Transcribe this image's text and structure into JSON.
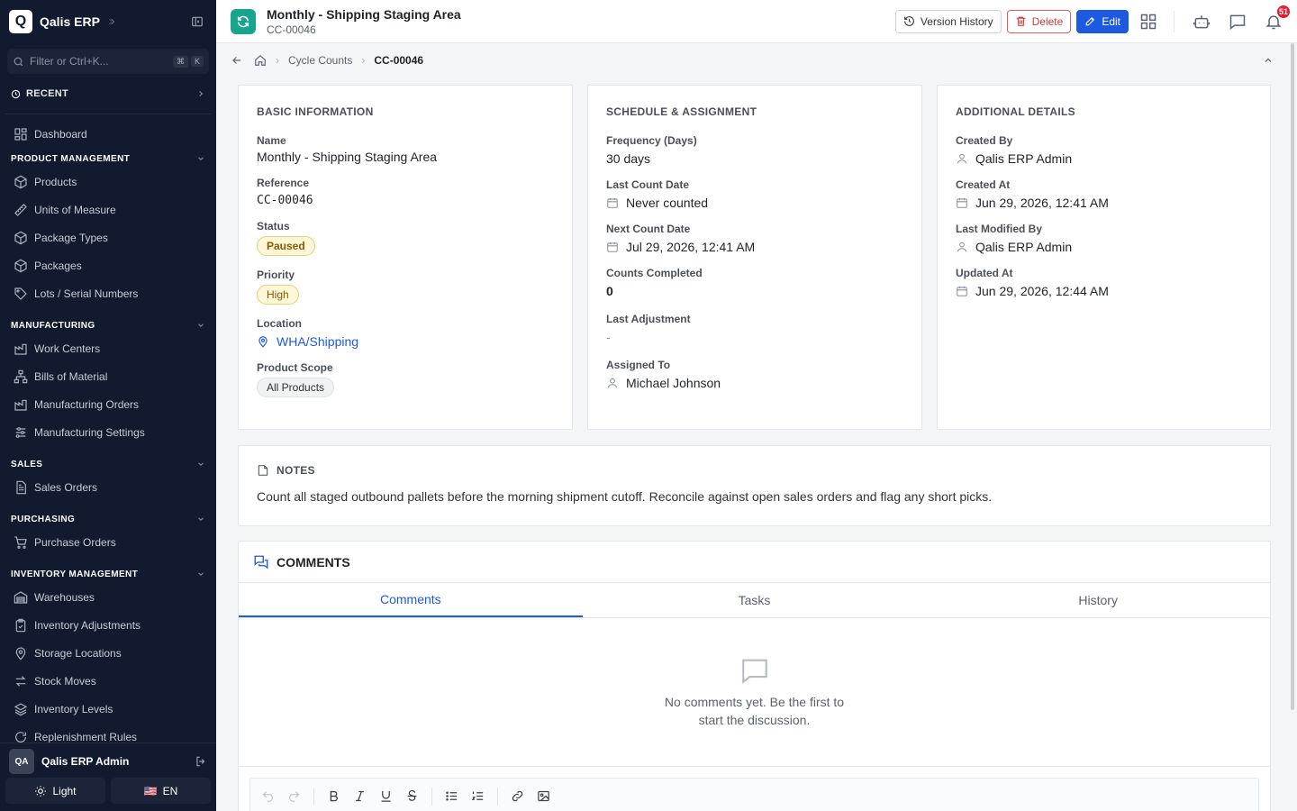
{
  "app": {
    "name": "Qalis ERP",
    "logo_letter": "Q"
  },
  "sidebar": {
    "filter_placeholder": "Filter or Ctrl+K...",
    "kbd_1": "⌘",
    "kbd_2": "K",
    "recent_label": "RECENT",
    "dashboard": "Dashboard",
    "sections": {
      "product": "PRODUCT MANAGEMENT",
      "manufacturing": "MANUFACTURING",
      "sales": "SALES",
      "purchasing": "PURCHASING",
      "inventory": "INVENTORY MANAGEMENT"
    },
    "product_items": [
      "Products",
      "Units of Measure",
      "Package Types",
      "Packages",
      "Lots / Serial Numbers"
    ],
    "manufacturing_items": [
      "Work Centers",
      "Bills of Material",
      "Manufacturing Orders",
      "Manufacturing Settings"
    ],
    "sales_items": [
      "Sales Orders"
    ],
    "purchasing_items": [
      "Purchase Orders"
    ],
    "inventory_items": [
      "Warehouses",
      "Inventory Adjustments",
      "Storage Locations",
      "Stock Moves",
      "Inventory Levels",
      "Replenishment Rules"
    ],
    "user": {
      "initials": "QA",
      "name": "Qalis ERP Admin"
    },
    "theme_label": "Light",
    "lang_label": "EN",
    "lang_flag": "🇺🇸"
  },
  "header": {
    "title": "Monthly - Shipping Staging Area",
    "subtitle": "CC-00046",
    "version_history": "Version History",
    "delete": "Delete",
    "edit": "Edit",
    "notification_count": "51"
  },
  "breadcrumb": {
    "parent": "Cycle Counts",
    "current": "CC-00046"
  },
  "basic": {
    "heading": "BASIC INFORMATION",
    "name_label": "Name",
    "name": "Monthly - Shipping Staging Area",
    "ref_label": "Reference",
    "ref": "CC-00046",
    "status_label": "Status",
    "status": "Paused",
    "priority_label": "Priority",
    "priority": "High",
    "location_label": "Location",
    "location": "WHA/Shipping",
    "scope_label": "Product Scope",
    "scope": "All Products"
  },
  "schedule": {
    "heading": "SCHEDULE & ASSIGNMENT",
    "freq_label": "Frequency (Days)",
    "freq": "30 days",
    "last_label": "Last Count Date",
    "last": "Never counted",
    "next_label": "Next Count Date",
    "next": "Jul 29, 2026, 12:41 AM",
    "completed_label": "Counts Completed",
    "completed": "0",
    "adj_label": "Last Adjustment",
    "adj": "-",
    "assigned_label": "Assigned To",
    "assigned": "Michael Johnson"
  },
  "additional": {
    "heading": "ADDITIONAL DETAILS",
    "created_by_label": "Created By",
    "created_by": "Qalis ERP Admin",
    "created_at_label": "Created At",
    "created_at": "Jun 29, 2026, 12:41 AM",
    "modified_by_label": "Last Modified By",
    "modified_by": "Qalis ERP Admin",
    "updated_at_label": "Updated At",
    "updated_at": "Jun 29, 2026, 12:44 AM"
  },
  "notes": {
    "heading": "NOTES",
    "body": "Count all staged outbound pallets before the morning shipment cutoff. Reconcile against open sales orders and flag any short picks."
  },
  "comments": {
    "heading": "COMMENTS",
    "tabs": [
      "Comments",
      "Tasks",
      "History"
    ],
    "empty_line1": "No comments yet. Be the first to",
    "empty_line2": "start the discussion."
  }
}
